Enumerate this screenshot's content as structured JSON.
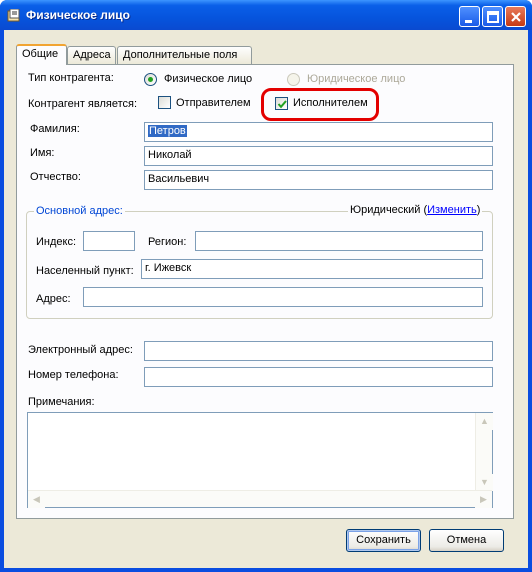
{
  "window": {
    "title": "Физическое лицо",
    "icons": {
      "app": "address-card-icon",
      "minimize": "minimize-icon",
      "maximize": "maximize-icon",
      "close": "close-icon"
    }
  },
  "tabs": [
    {
      "label": "Общие",
      "active": true
    },
    {
      "label": "Адреса",
      "active": false
    },
    {
      "label": "Дополнительные поля",
      "active": false
    }
  ],
  "form": {
    "counterparty_type": {
      "label": "Тип контрагента:",
      "options": [
        {
          "label": "Физическое лицо",
          "selected": true,
          "enabled": true
        },
        {
          "label": "Юридическое лицо",
          "selected": false,
          "enabled": false
        }
      ]
    },
    "role": {
      "label": "Контрагент является:",
      "sender": {
        "label": "Отправителем",
        "checked": false
      },
      "executor": {
        "label": "Исполнителем",
        "checked": true
      }
    },
    "last_name": {
      "label": "Фамилия:",
      "value": "Петров"
    },
    "first_name": {
      "label": "Имя:",
      "value": "Николай"
    },
    "patronymic": {
      "label": "Отчество:",
      "value": "Васильевич"
    },
    "address_group": {
      "title": "Основной адрес:",
      "kind": "Юридический (",
      "change_link": "Изменить",
      "kind_close": ")",
      "index": {
        "label": "Индекс:",
        "value": ""
      },
      "region": {
        "label": "Регион:",
        "value": ""
      },
      "locality": {
        "label": "Населенный пункт:",
        "value": "г. Ижевск"
      },
      "address": {
        "label": "Адрес:",
        "value": ""
      }
    },
    "email": {
      "label": "Электронный адрес:",
      "value": ""
    },
    "phone": {
      "label": "Номер телефона:",
      "value": ""
    },
    "notes": {
      "label": "Примечания:",
      "value": ""
    }
  },
  "buttons": {
    "save": "Сохранить",
    "cancel": "Отмена"
  },
  "colors": {
    "titlebar": "#0654dd",
    "highlight": "#e30000",
    "dialog_bg": "#ece9d8",
    "link": "#0000ff"
  }
}
